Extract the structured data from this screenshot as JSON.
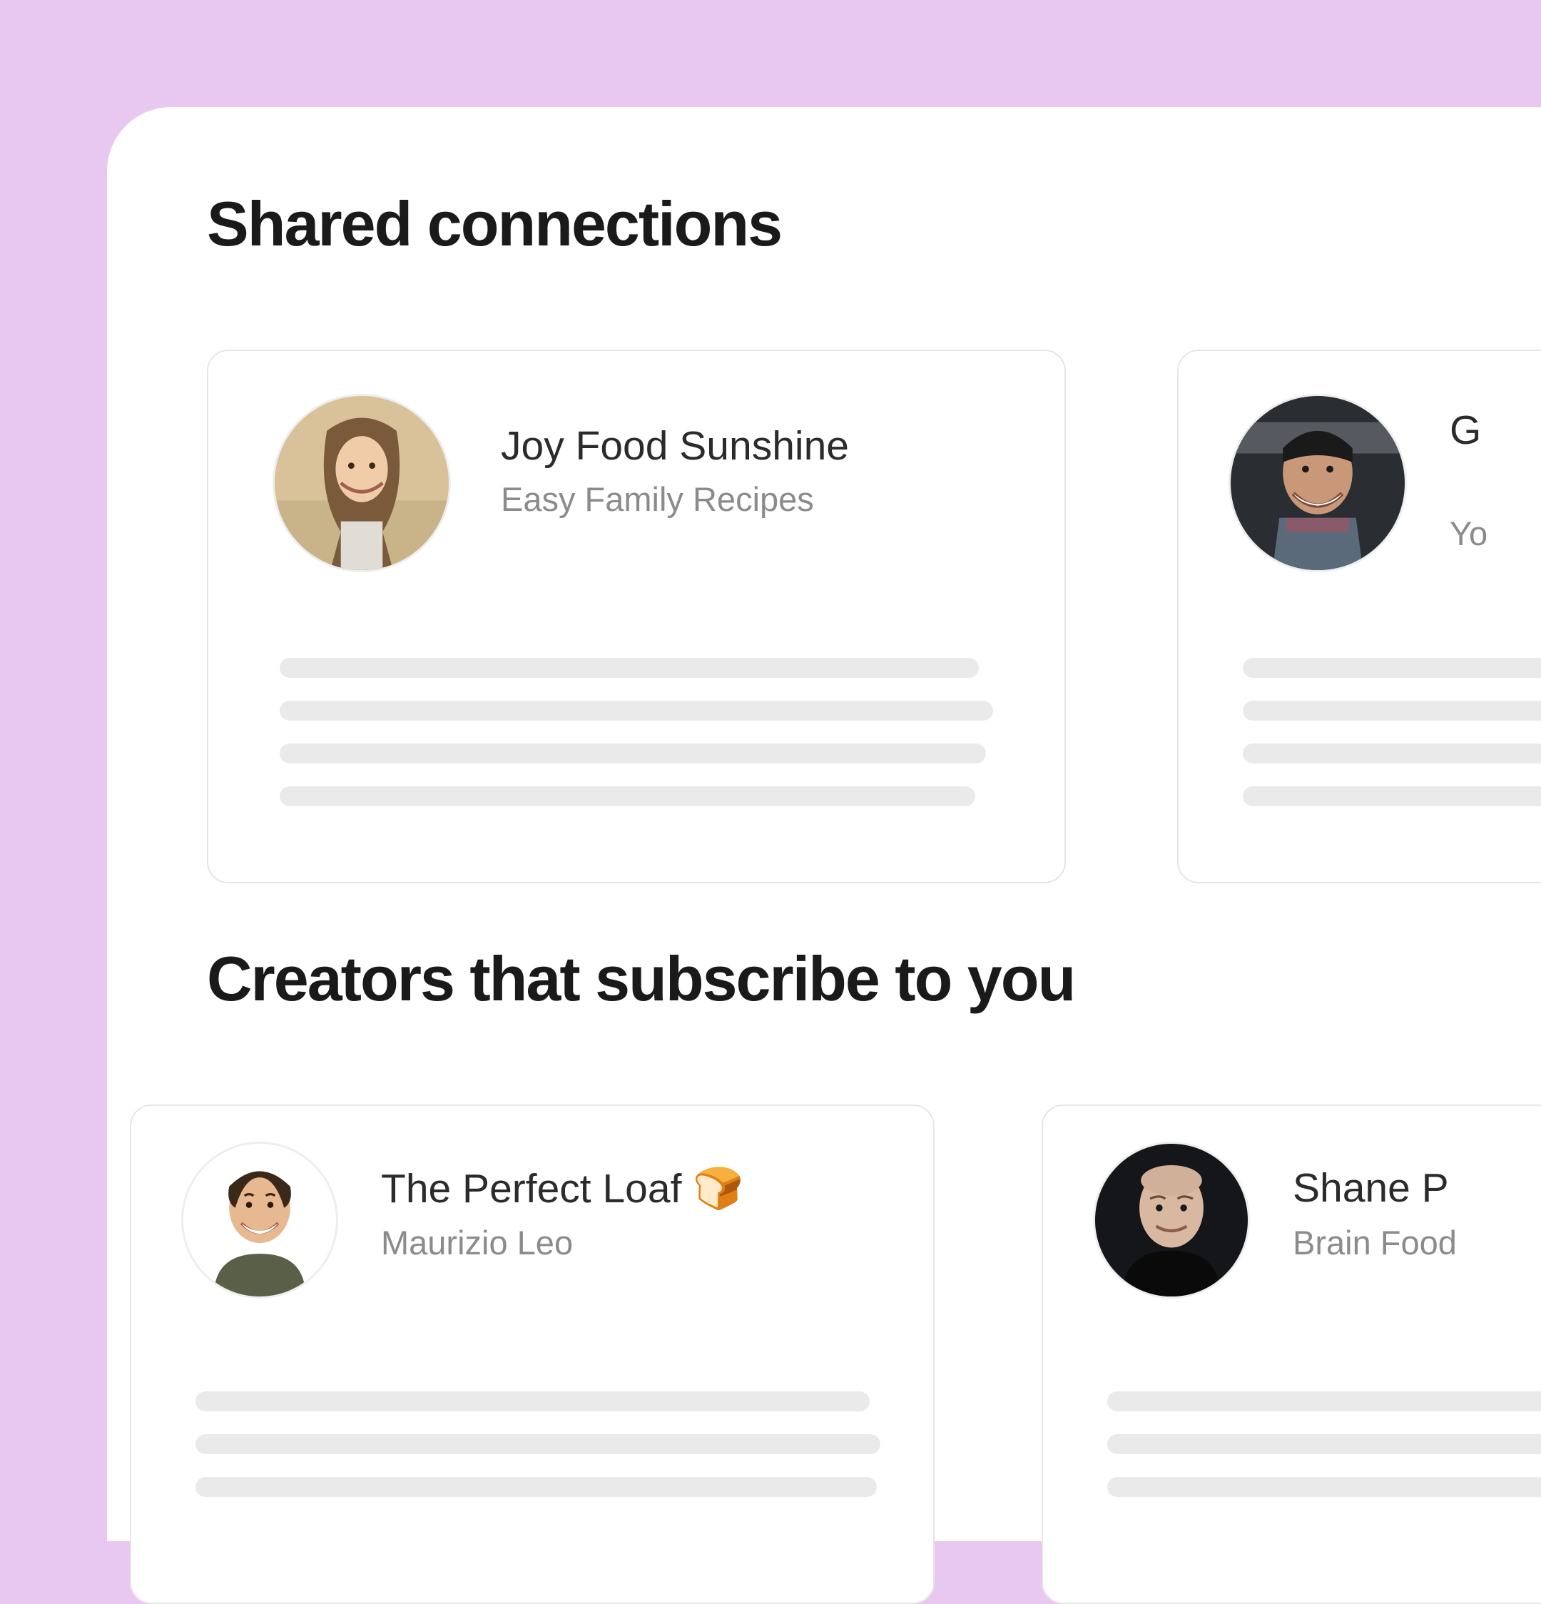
{
  "sections": {
    "shared": {
      "title": "Shared connections",
      "cards": [
        {
          "name": "Joy Food Sunshine",
          "subtitle": "Easy Family Recipes"
        },
        {
          "name": "G",
          "subtitle": "Yo"
        }
      ]
    },
    "subscribers": {
      "title": "Creators that subscribe to you",
      "cards": [
        {
          "name": "The Perfect Loaf 🍞",
          "subtitle": "Maurizio Leo"
        },
        {
          "name": "Shane P",
          "subtitle": "Brain Food"
        }
      ]
    }
  }
}
